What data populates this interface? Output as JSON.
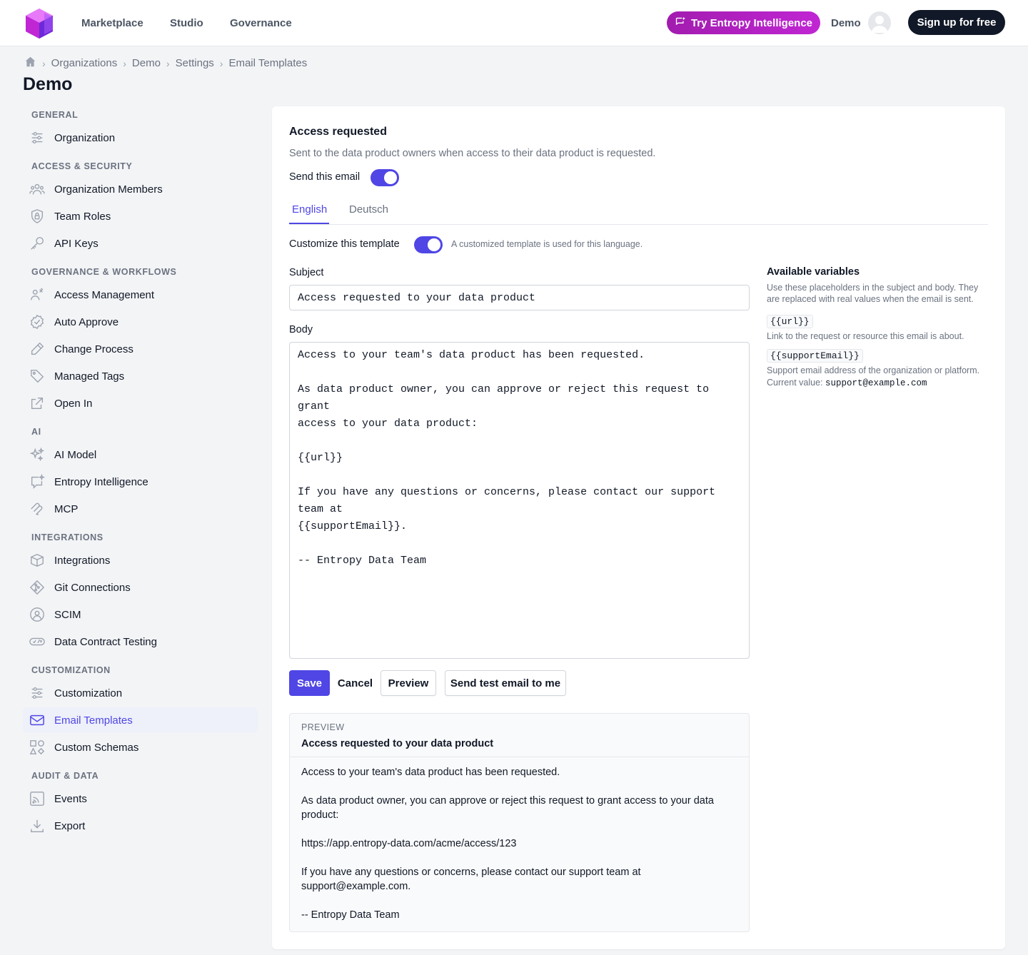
{
  "nav": {
    "links": [
      "Marketplace",
      "Studio",
      "Governance"
    ],
    "try_label": "Try Entropy Intelligence",
    "org_label": "Demo",
    "signup_label": "Sign up for free"
  },
  "breadcrumb": [
    "Organizations",
    "Demo",
    "Settings",
    "Email Templates"
  ],
  "page_title": "Demo",
  "sidebar": {
    "sections": {
      "general": "GENERAL",
      "access": "ACCESS & SECURITY",
      "governance": "GOVERNANCE & WORKFLOWS",
      "ai": "AI",
      "integrations": "INTEGRATIONS",
      "customization": "CUSTOMIZATION",
      "audit": "AUDIT & DATA"
    },
    "items": {
      "organization": "Organization",
      "members": "Organization Members",
      "team_roles": "Team Roles",
      "api_keys": "API Keys",
      "access_mgmt": "Access Management",
      "auto_approve": "Auto Approve",
      "change_process": "Change Process",
      "managed_tags": "Managed Tags",
      "open_in": "Open In",
      "ai_model": "AI Model",
      "entropy_intel": "Entropy Intelligence",
      "mcp": "MCP",
      "integrations": "Integrations",
      "git": "Git Connections",
      "scim": "SCIM",
      "dct": "Data Contract Testing",
      "customization": "Customization",
      "email_templates": "Email Templates",
      "custom_schemas": "Custom Schemas",
      "events": "Events",
      "export": "Export"
    }
  },
  "template": {
    "title": "Access requested",
    "description": "Sent to the data product owners when access to their data product is requested.",
    "send_label": "Send this email",
    "send_enabled": true,
    "tabs": [
      "English",
      "Deutsch"
    ],
    "active_tab": "English",
    "customize_label": "Customize this template",
    "customize_enabled": true,
    "customize_hint": "A customized template is used for this language.",
    "subject_label": "Subject",
    "subject_value": "Access requested to your data product",
    "body_label": "Body",
    "body_value": "Access to your team's data product has been requested.\n\nAs data product owner, you can approve or reject this request to grant\naccess to your data product:\n\n{{url}}\n\nIf you have any questions or concerns, please contact our support team at\n{{supportEmail}}.\n\n-- Entropy Data Team",
    "buttons": {
      "save": "Save",
      "cancel": "Cancel",
      "preview": "Preview",
      "send_test": "Send test email to me"
    }
  },
  "variables": {
    "title": "Available variables",
    "description": "Use these placeholders in the subject and body. They are replaced with real values when the email is sent.",
    "url_name": "{{url}}",
    "url_desc": "Link to the request or resource this email is about.",
    "support_name": "{{supportEmail}}",
    "support_desc": "Support email address of the organization or platform.",
    "support_current_label": "Current value:",
    "support_current_value": "support@example.com"
  },
  "preview": {
    "label": "PREVIEW",
    "subject": "Access requested to your data product",
    "p1": "Access to your team's data product has been requested.",
    "p2": "As data product owner, you can approve or reject this request to grant access to your data product:",
    "p3": "https://app.entropy-data.com/acme/access/123",
    "p4": "If you have any questions or concerns, please contact our support team at support@example.com.",
    "p5": "-- Entropy Data Team"
  },
  "colors": {
    "accent": "#4f46e5",
    "brand_gradient_start": "#a21caf",
    "dark": "#111827"
  }
}
